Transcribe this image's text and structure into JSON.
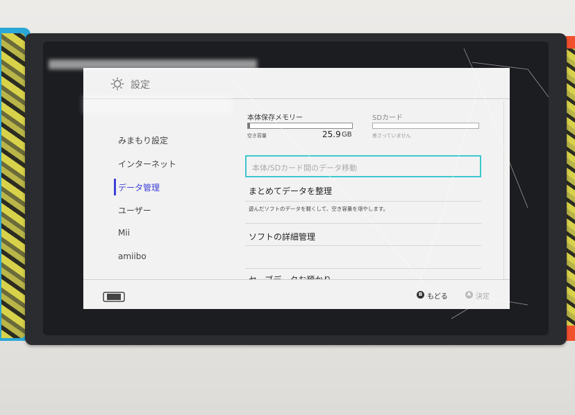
{
  "header": {
    "title": "設定",
    "icon": "gear-icon"
  },
  "sidebar": {
    "items": [
      {
        "label": "みまもり設定"
      },
      {
        "label": "インターネット"
      },
      {
        "label": "データ管理",
        "active": true
      },
      {
        "label": "ユーザー"
      },
      {
        "label": "Mii"
      },
      {
        "label": "amiibo"
      }
    ]
  },
  "storage": {
    "system": {
      "label": "本体保存メモリー",
      "free_label": "空き容量",
      "free_value": "25.9",
      "unit": "GB",
      "fill": 0.02
    },
    "sd": {
      "label": "SDカード",
      "status": "差さっていません"
    }
  },
  "main": {
    "selected_row": {
      "label": "本体/SDカード間のデータ移動"
    },
    "rows": [
      {
        "title": "まとめてデータを整理",
        "desc": "遊んだソフトのデータを軽くして、空き容量を増やします。"
      },
      {
        "title": "ソフトの詳細管理",
        "desc": ""
      },
      {
        "title": "セーブデータお預かり",
        "desc": ""
      }
    ]
  },
  "footer": {
    "back": {
      "button": "B",
      "label": "もどる"
    },
    "ok": {
      "button": "A",
      "label": "決定"
    }
  },
  "colors": {
    "accent": "#3d3fd6",
    "selection": "#3bc8cf",
    "background": "#f2f2f2"
  }
}
